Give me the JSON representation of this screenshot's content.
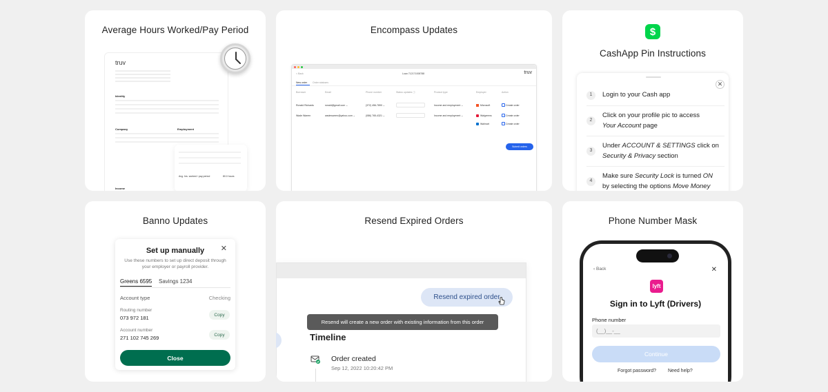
{
  "cards": {
    "hours": {
      "title": "Average Hours Worked/Pay Period",
      "doc_logo": "truv",
      "identity": "Identity",
      "company": "Company",
      "employment": "Employment",
      "income": "Income",
      "avg_label": "Avg. hrs. worked / pay period",
      "avg_value": "80.0 hours"
    },
    "encompass": {
      "title": "Encompass Updates",
      "back": "< Back",
      "loan": "Loan 712171008788",
      "logo": "truv",
      "tab_new": "New order",
      "tab_status": "Order statuses",
      "cols": [
        "Borrower",
        "Email",
        "Phone number",
        "Status updates ⓘ",
        "Product type",
        "Employer",
        "Action"
      ],
      "rows": [
        {
          "borrower": "Ronald Richards",
          "email": "ronald@gmail.com ⌄",
          "phone": "(372) 456-7890 ⌄",
          "product": "Income and employment ⌄",
          "employers": [
            "Microsoft"
          ],
          "action": "Create order"
        },
        {
          "borrower": "Wade Warren",
          "email": "wadewarren@yahoo.com ⌄",
          "phone": "(086) 765-4321 ⌄",
          "product": "Income and employment ⌄",
          "employers": [
            "Walgreens",
            "Walmart"
          ],
          "action": "Create order"
        }
      ],
      "submit": "Submit orders"
    },
    "cashapp": {
      "title": "CashApp Pin Instructions",
      "icon": "$",
      "steps": [
        {
          "n": "1",
          "html_a": "Login to your Cash app",
          "b": "",
          "c": ""
        },
        {
          "n": "2",
          "html_a": "Click on your profile pic to access ",
          "b": "Your Account",
          "c": " page"
        },
        {
          "n": "3",
          "html_a": "Under ",
          "b": "ACCOUNT & SETTINGS",
          "c": " click on "
        },
        {
          "n": "4",
          "html_a": "Make sure ",
          "b": "Security Lock",
          "c": " is turned "
        }
      ],
      "step3_b2": "Security & Privacy",
      "step3_c2": " section",
      "step4_b2": "ON",
      "step4_c2": "by selecting the options ",
      "step4_b3": "Move Money"
    },
    "banno": {
      "title": "Banno Updates",
      "modal_title": "Set up manually",
      "close_x": "✕",
      "subtitle": "Use these numbers to set up direct deposit through your employer or payroll provider.",
      "tab1": "Greens 6595",
      "tab2": "Savings 1234",
      "account_type_label": "Account type",
      "account_type_value": "Checking",
      "routing_label": "Routing number",
      "routing_value": "073 972 181",
      "account_label": "Account number",
      "account_value": "271 102 745 269",
      "copy": "Copy",
      "close": "Close"
    },
    "resend": {
      "title": "Resend Expired Orders",
      "button": "Resend expired order",
      "tooltip": "Resend will create a new order with existing information from this order",
      "timeline": "Timeline",
      "order_created": "Order created",
      "order_date": "Sep 12, 2022 10:20:42 PM"
    },
    "phone": {
      "title": "Phone Number Mask",
      "back": "Back",
      "close": "✕",
      "lyft_logo": "lyft",
      "heading": "Sign in to Lyft (Drivers)",
      "phone_label": "Phone number",
      "phone_placeholder": "(__)__-__",
      "continue": "Continue",
      "forgot": "Forgot password?",
      "help": "Need help?"
    }
  }
}
